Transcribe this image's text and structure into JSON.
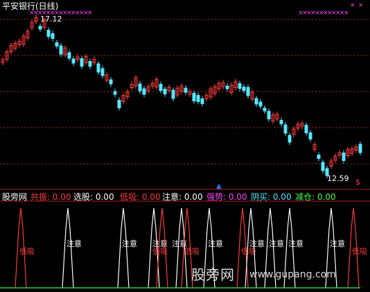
{
  "chart": {
    "title": "平安银行(日线)",
    "high_label": "17.12",
    "low_label": "12.59",
    "corner_icon": "dollar-sign-icon",
    "corner_glyph": "$"
  },
  "indicator": {
    "name": "股旁网",
    "items": [
      {
        "label": "共振:",
        "value": "0.00",
        "color": "#ff3b3b"
      },
      {
        "label": "选股:",
        "value": "0.00",
        "color": "#ffffff"
      },
      {
        "label": "低吸:",
        "value": "0.00",
        "color": "#ff3b3b"
      },
      {
        "label": "注意:",
        "value": "0.00",
        "color": "#ffffff"
      },
      {
        "label": "强势:",
        "value": "0.00",
        "color": "#ff44ff"
      },
      {
        "label": "阴买:",
        "value": "0.00",
        "color": "#55e6ff"
      },
      {
        "label": "减仓:",
        "value": "0.00",
        "color": "#44ff44"
      }
    ],
    "signals": [
      "低吸",
      "注意",
      "注意",
      "注意",
      "低吸",
      "注意",
      "低吸",
      "注意",
      "低吸",
      "注意",
      "注意",
      "注意",
      "注意",
      "低吸"
    ]
  },
  "watermark": {
    "logo_text": "股旁网",
    "url": "www.gupang.com"
  },
  "colors": {
    "up": "#ff3b3b",
    "down": "#55e6ff",
    "grid": "#b02020",
    "signal_red": "#ff3b3b",
    "signal_white": "#ffffff",
    "baseline": "#2ecc40",
    "x_marks": "#ff44ff"
  }
}
